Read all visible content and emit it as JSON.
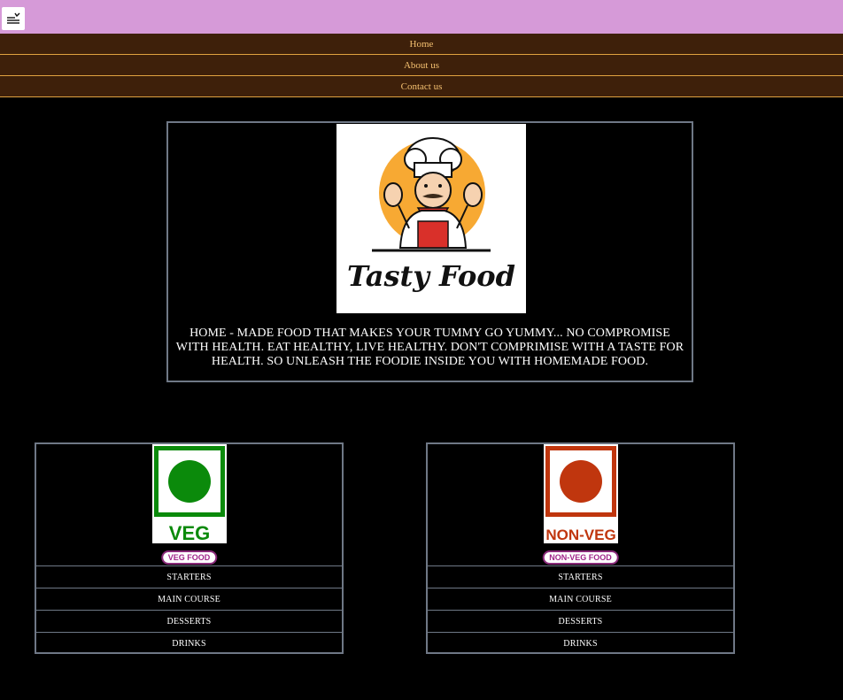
{
  "header": {
    "menu_icon": "menu-lines-icon",
    "bar_color": "#d69ad8"
  },
  "nav": {
    "items": [
      "Home",
      "About us",
      "Contact us"
    ],
    "bg_color": "#3e200a",
    "text_color": "#f4c070"
  },
  "hero": {
    "logo_text": "Tasty Food",
    "tagline": "HOME - MADE FOOD THAT MAKES YOUR TUMMY GO YUMMY... NO COMPROMISE WITH HEALTH. EAT HEALTHY, LIVE HEALTHY. DON'T COMPRIMISE WITH A TASTE FOR HEALTH. SO UNLEASH THE FOODIE INSIDE YOU WITH HOMEMADE FOOD."
  },
  "veg": {
    "symbol_label": "VEG",
    "pill_label": "VEG FOOD",
    "color": "#0b8a0b",
    "items": [
      "STARTERS",
      "MAIN COURSE",
      "DESSERTS",
      "DRINKS"
    ]
  },
  "nonveg": {
    "symbol_label": "NON-VEG",
    "pill_label": "NON-VEG FOOD",
    "color": "#c0360e",
    "items": [
      "STARTERS",
      "MAIN COURSE",
      "DESSERTS",
      "DRINKS"
    ]
  }
}
